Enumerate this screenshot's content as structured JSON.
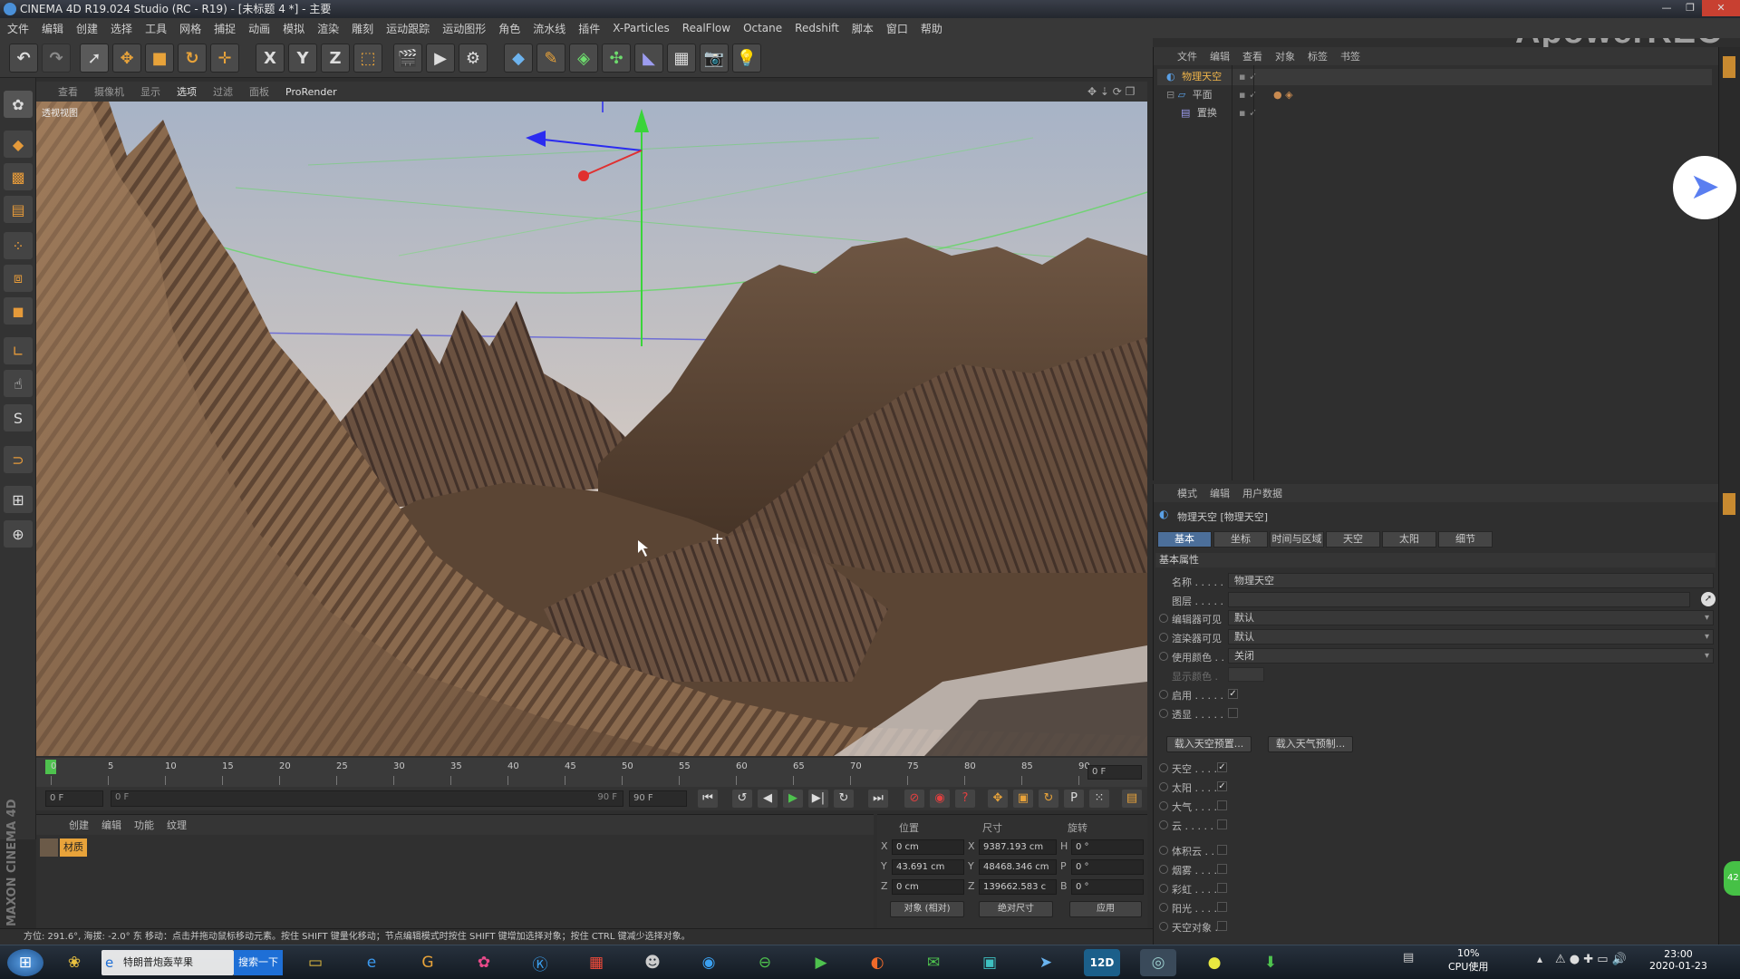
{
  "titlebar": {
    "title": "CINEMA 4D R19.024 Studio (RC - R19) - [未标题 4 *] - 主要"
  },
  "watermark": "ApowerREC",
  "menubar": [
    "文件",
    "编辑",
    "创建",
    "选择",
    "工具",
    "网格",
    "捕捉",
    "动画",
    "模拟",
    "渲染",
    "雕刻",
    "运动跟踪",
    "运动图形",
    "角色",
    "流水线",
    "插件",
    "X-Particles",
    "RealFlow",
    "Octane",
    "Redshift",
    "脚本",
    "窗口",
    "帮助"
  ],
  "toolbar": {
    "axis_x": "X",
    "axis_y": "Y",
    "axis_z": "Z"
  },
  "viewport": {
    "menu": [
      "查看",
      "摄像机",
      "显示",
      "选项",
      "过滤",
      "面板"
    ],
    "menu_extra": "ProRender",
    "label": "透视视图"
  },
  "timeline": {
    "ticks": [
      "0",
      "5",
      "10",
      "15",
      "20",
      "25",
      "30",
      "35",
      "40",
      "45",
      "50",
      "55",
      "60",
      "65",
      "70",
      "75",
      "80",
      "85",
      "90"
    ],
    "current_frame": "0 F"
  },
  "playbar": {
    "start": "0 F",
    "range_start": "0 F",
    "range_end": "90 F",
    "end": "90 F"
  },
  "material_panel": {
    "tabs": [
      "创建",
      "编辑",
      "功能",
      "纹理"
    ],
    "material_name": "材质"
  },
  "coords": {
    "headers": {
      "position": "位置",
      "size": "尺寸",
      "rotation": "旋转"
    },
    "rows": [
      {
        "axis": "X",
        "pos": "0 cm",
        "size_axis": "X",
        "size": "9387.193 cm",
        "rot_axis": "H",
        "rot": "0 °"
      },
      {
        "axis": "Y",
        "pos": "43.691 cm",
        "size_axis": "Y",
        "size": "48468.346 cm",
        "rot_axis": "P",
        "rot": "0 °"
      },
      {
        "axis": "Z",
        "pos": "0 cm",
        "size_axis": "Z",
        "size": "139662.583 c",
        "rot_axis": "B",
        "rot": "0 °"
      }
    ],
    "mode": "对象 (相对)",
    "size_mode": "绝对尺寸",
    "apply": "应用"
  },
  "status": "方位: 291.6°, 海拔: -2.0° 东     移动：点击并拖动鼠标移动元素。按住 SHIFT 键量化移动；节点编辑模式时按住 SHIFT 键增加选择对象；按住 CTRL 键减少选择对象。",
  "maxon": "MAXON CINEMA 4D",
  "object_manager": {
    "menu": [
      "文件",
      "编辑",
      "查看",
      "对象",
      "标签",
      "书签"
    ],
    "objects": [
      {
        "name": "物理天空",
        "selected": true
      },
      {
        "name": "平面",
        "selected": false
      },
      {
        "name": "置换",
        "selected": false
      }
    ]
  },
  "attribute_manager": {
    "menu": [
      "模式",
      "编辑",
      "用户数据"
    ],
    "object_title": "物理天空 [物理天空]",
    "tabs": [
      "基本",
      "坐标",
      "时间与区域",
      "天空",
      "太阳",
      "细节"
    ],
    "section": "基本属性",
    "fields": {
      "name_label": "名称 . . . . .",
      "name_value": "物理天空",
      "layer_label": "图层 . . . . .",
      "editor_visible_label": "编辑器可见",
      "editor_visible_value": "默认",
      "render_visible_label": "渲染器可见",
      "render_visible_value": "默认",
      "use_color_label": "使用颜色 . .",
      "use_color_value": "关闭",
      "display_color_label": "显示颜色 .",
      "enable_label": "启用 . . . . .",
      "xray_label": "透显 . . . . ."
    },
    "buttons": {
      "load_sky": "载入天空预置...",
      "load_weather": "载入天气预制..."
    },
    "options": [
      {
        "label": "天空 . . . .",
        "checked": true
      },
      {
        "label": "太阳 . . . .",
        "checked": true
      },
      {
        "label": "大气 . . . .",
        "checked": false
      },
      {
        "label": "云 . . . . . .",
        "checked": false
      },
      {
        "label": "体积云 . . .",
        "checked": false
      },
      {
        "label": "烟雾 . . . .",
        "checked": false
      },
      {
        "label": "彩虹 . . . .",
        "checked": false
      },
      {
        "label": "阳光 . . . .",
        "checked": false
      },
      {
        "label": "天空对象 .",
        "checked": false
      }
    ]
  },
  "taskbar": {
    "active_window": "特朗普炮轰苹果",
    "search_button": "搜索一下",
    "app_12d": "12D",
    "cpu_percent": "10%",
    "cpu_label": "CPU使用",
    "time": "23:00",
    "date": "2020-01-23"
  },
  "status_badge": "42"
}
